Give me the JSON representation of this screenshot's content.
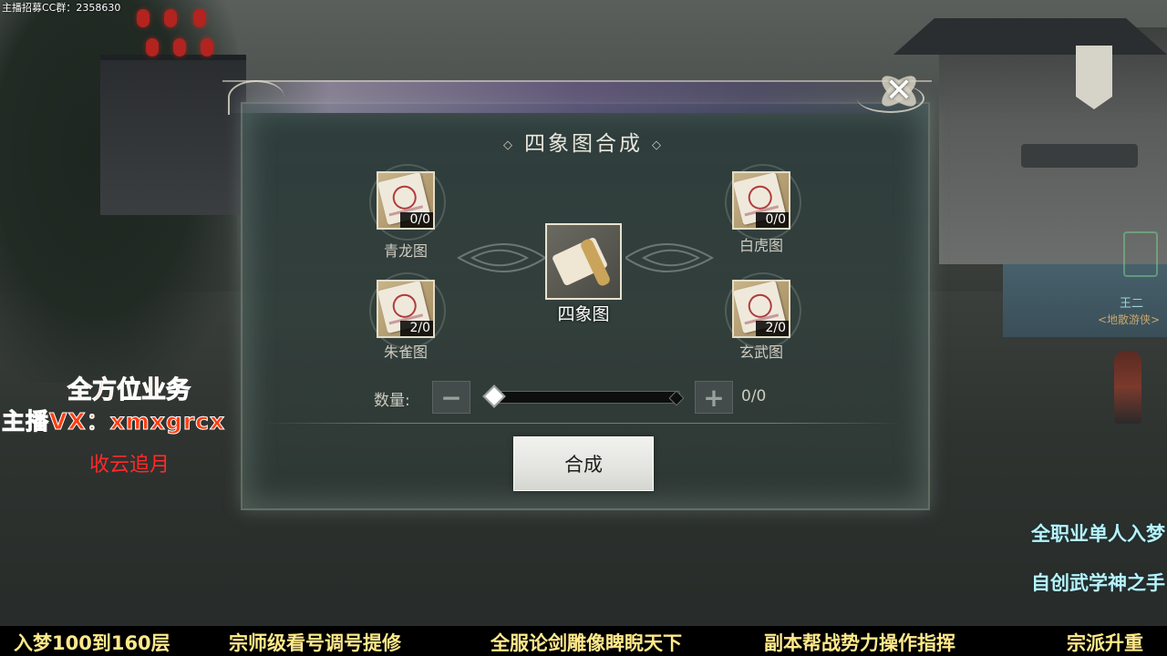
{
  "stream": {
    "top_info": "主播招募CC群：2358630",
    "promo_left": [
      "全方位业务",
      "主播VX：xmxgrcx",
      "收云追月"
    ],
    "promo_right": [
      "全职业单人入梦",
      "自创武学神之手"
    ],
    "ticker": [
      "入梦100到160层",
      "宗师级看号调号提修",
      "全服论剑雕像睥睨天下",
      "副本帮战势力操作指挥",
      "宗派升重"
    ]
  },
  "scene": {
    "npc_name": "王二",
    "npc_title": "<地散游侠>"
  },
  "dialog": {
    "title": "四象图合成",
    "close_symbol": "✕",
    "items": [
      {
        "name": "青龙图",
        "count": "0/0",
        "icon": "scroll-icon"
      },
      {
        "name": "白虎图",
        "count": "0/0",
        "icon": "scroll-icon"
      },
      {
        "name": "朱雀图",
        "count": "2/0",
        "icon": "scroll-icon"
      },
      {
        "name": "玄武图",
        "count": "2/0",
        "icon": "scroll-icon"
      }
    ],
    "result": {
      "name": "四象图",
      "icon": "scroll-icon"
    },
    "quantity": {
      "label": "数量:",
      "minus": "−",
      "plus": "+",
      "value": "0/0",
      "slider_fraction": 0
    },
    "synth_button": "合成"
  },
  "colors": {
    "promo_orange": "#ff5a18",
    "promo_red": "#ff2a2a",
    "promo_cyan": "#b8f3f7",
    "ticker_yellow": "#ffe98a"
  }
}
